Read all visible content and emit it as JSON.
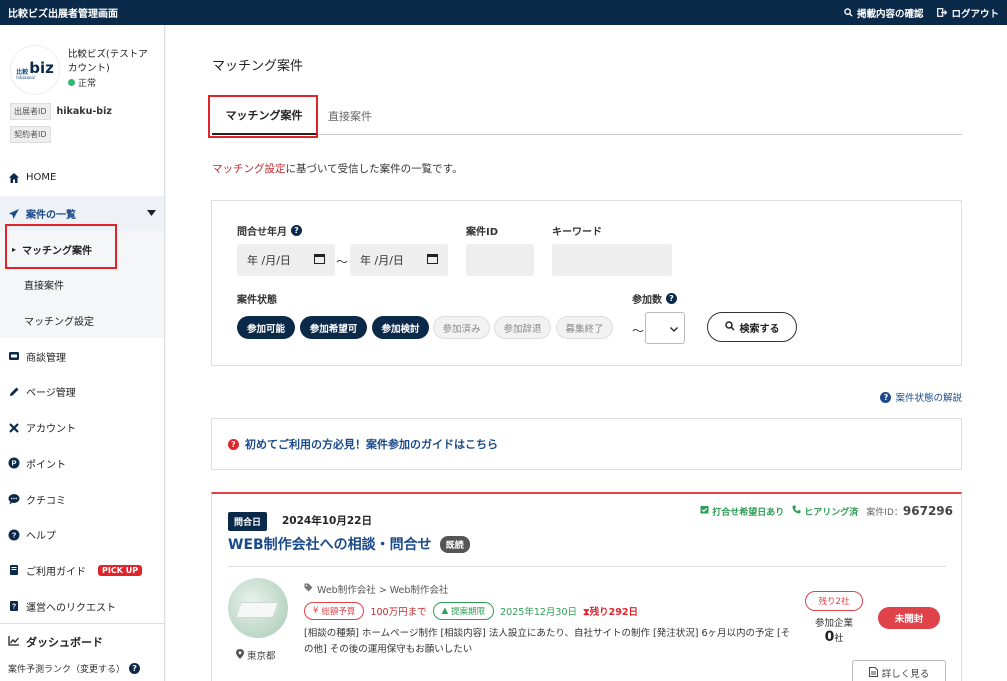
{
  "topbar": {
    "title": "比較ビズ出展者管理画面",
    "check_label": "掲載内容の確認",
    "logout_label": "ログアウト"
  },
  "profile": {
    "logo_small": "比較",
    "logo_big": "biz",
    "logo_sub": "hikakubiz",
    "account_name": "比較ビズ(テストアカウント)",
    "status": "正常",
    "exhibitor_id_label": "出展者ID",
    "exhibitor_id": "hikaku-biz",
    "contractor_id_label": "契約者ID"
  },
  "nav": {
    "home": "HOME",
    "cases": "案件の一覧",
    "sub": [
      "マッチング案件",
      "直接案件",
      "マッチング設定"
    ],
    "business": "商談管理",
    "page": "ページ管理",
    "account": "アカウント",
    "points": "ポイント",
    "reviews": "クチコミ",
    "help": "ヘルプ",
    "guide": "ご利用ガイド",
    "pickup": "PICK UP",
    "request": "運営へのリクエスト",
    "dashboard": "ダッシュボード",
    "ranking": "案件予測ランク（変更する）"
  },
  "main": {
    "title": "マッチング案件",
    "tabs": [
      "マッチング案件",
      "直接案件"
    ],
    "desc_link": "マッチング設定",
    "desc_rest": "に基づいて受信した案件の一覧です。"
  },
  "filter": {
    "date_label": "問合せ年月",
    "date_placeholder": "年 /月/日",
    "tilde": "〜",
    "case_id_label": "案件ID",
    "keyword_label": "キーワード",
    "status_label": "案件状態",
    "count_label": "参加数",
    "chips_on": [
      "参加可能",
      "参加希望可",
      "参加検討"
    ],
    "chips_off": [
      "参加済み",
      "参加辞退",
      "募集終了"
    ],
    "search_label": "検索する"
  },
  "help_link": "案件状態の解説",
  "guide_text": "初めてご利用の方必見！案件参加のガイドはこちら",
  "card": {
    "date_badge": "問合日",
    "date": "2024年10月22日",
    "meta_meeting": "打合せ希望日あり",
    "meta_hearing": "ヒアリング済",
    "case_id_label": "案件ID：",
    "case_id": "967296",
    "title": "WEB制作会社への相談・問合せ",
    "read_badge": "既読",
    "category": "Web制作会社 > Web制作会社",
    "budget_label": "総額予算",
    "budget": "100万円まで",
    "deadline_label": "提案期限",
    "deadline": "2025年12月30日",
    "remaining_days": "残り292日",
    "description": "[相談の種類] ホームページ制作 [相談内容] 法人設立にあたり、自社サイトの制作 [発注状況] 6ヶ月以内の予定 [その他] その後の運用保守もお願いしたい",
    "location": "東京都",
    "remaining_slots": "残り2社",
    "participants_label": "参加企業",
    "participants": "0",
    "participants_unit": "社",
    "unopened": "未開封",
    "detail_label": "詳しく見る"
  },
  "colors": {
    "navy": "#0b2a4a",
    "red": "#e0242b",
    "green": "#2e9e54",
    "link": "#1a4a8a"
  }
}
